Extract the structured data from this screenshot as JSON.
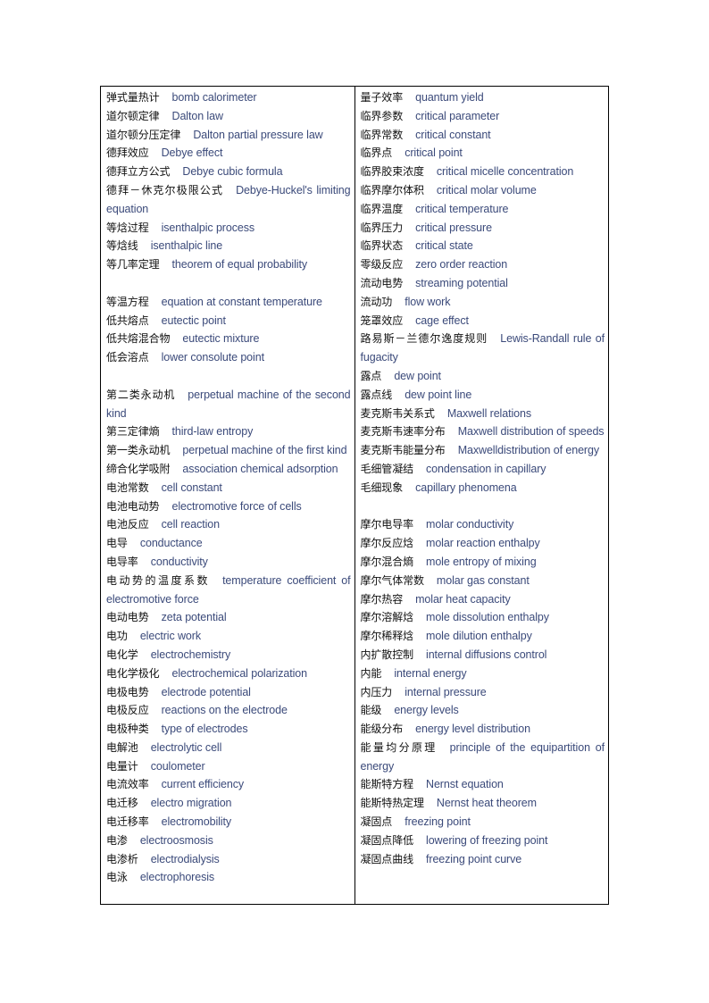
{
  "document": {
    "left_column": [
      {
        "zh": "弹式量热计",
        "en": "bomb calorimeter"
      },
      {
        "zh": "道尔顿定律",
        "en": "Dalton law"
      },
      {
        "zh": "道尔顿分压定律",
        "en": "Dalton partial pressure law"
      },
      {
        "zh": "德拜效应",
        "en": "Debye effect"
      },
      {
        "zh": "德拜立方公式",
        "en": "Debye cubic formula"
      },
      {
        "zh": "德拜－休克尔极限公式",
        "en": "Debye-Huckel's limiting equation"
      },
      {
        "zh": "等焓过程",
        "en": "isenthalpic process"
      },
      {
        "zh": "等焓线",
        "en": "isenthalpic line"
      },
      {
        "zh": "等几率定理",
        "en": "theorem of equal probability"
      },
      {
        "zh": "",
        "en": ""
      },
      {
        "zh": "等温方程",
        "en": "equation at constant temperature"
      },
      {
        "zh": "低共熔点",
        "en": "eutectic point"
      },
      {
        "zh": "低共熔混合物",
        "en": "eutectic mixture"
      },
      {
        "zh": "低会溶点",
        "en": "lower consolute point"
      },
      {
        "zh": "",
        "en": ""
      },
      {
        "zh": "第二类永动机",
        "en": "perpetual machine of the second kind"
      },
      {
        "zh": "第三定律熵",
        "en": "third-law entropy"
      },
      {
        "zh": "第一类永动机",
        "en": "perpetual machine of the first kind"
      },
      {
        "zh": "缔合化学吸附",
        "en": "association chemical adsorption"
      },
      {
        "zh": "电池常数",
        "en": "cell constant"
      },
      {
        "zh": "电池电动势",
        "en": "electromotive force of cells"
      },
      {
        "zh": "电池反应",
        "en": "cell reaction"
      },
      {
        "zh": "电导",
        "en": "conductance"
      },
      {
        "zh": "电导率",
        "en": "conductivity"
      },
      {
        "zh": "电动势的温度系数",
        "en": "temperature coefficient of electromotive force"
      },
      {
        "zh": "电动电势",
        "en": "zeta potential"
      },
      {
        "zh": "电功",
        "en": "electric work"
      },
      {
        "zh": "电化学",
        "en": "electrochemistry"
      },
      {
        "zh": "电化学极化",
        "en": "electrochemical polarization"
      },
      {
        "zh": "电极电势",
        "en": "electrode potential"
      },
      {
        "zh": "电极反应",
        "en": "reactions on the electrode"
      },
      {
        "zh": "电极种类",
        "en": "type of electrodes"
      },
      {
        "zh": "电解池",
        "en": "electrolytic cell"
      },
      {
        "zh": "电量计",
        "en": "coulometer"
      },
      {
        "zh": "电流效率",
        "en": "current efficiency"
      },
      {
        "zh": "电迁移",
        "en": "electro migration"
      },
      {
        "zh": "电迁移率",
        "en": "electromobility"
      },
      {
        "zh": "电渗",
        "en": "electroosmosis"
      },
      {
        "zh": "电渗析",
        "en": "electrodialysis"
      },
      {
        "zh": "电泳",
        "en": "electrophoresis"
      }
    ],
    "right_column": [
      {
        "zh": "量子效率",
        "en": "quantum yield"
      },
      {
        "zh": "临界参数",
        "en": "critical parameter"
      },
      {
        "zh": "临界常数",
        "en": "critical constant"
      },
      {
        "zh": "临界点",
        "en": "critical point"
      },
      {
        "zh": "临界胶束浓度",
        "en": "critical micelle concentration"
      },
      {
        "zh": "临界摩尔体积",
        "en": "critical molar volume"
      },
      {
        "zh": "临界温度",
        "en": "critical temperature"
      },
      {
        "zh": "临界压力",
        "en": "critical pressure"
      },
      {
        "zh": "临界状态",
        "en": "critical state"
      },
      {
        "zh": "零级反应",
        "en": "zero order reaction"
      },
      {
        "zh": "流动电势",
        "en": "streaming potential"
      },
      {
        "zh": "流动功",
        "en": "flow work"
      },
      {
        "zh": "笼罩效应",
        "en": "cage effect"
      },
      {
        "zh": "路易斯－兰德尔逸度规则",
        "en": "Lewis-Randall rule of fugacity"
      },
      {
        "zh": "露点",
        "en": "dew point"
      },
      {
        "zh": "露点线",
        "en": "dew point line"
      },
      {
        "zh": "麦克斯韦关系式",
        "en": "Maxwell relations"
      },
      {
        "zh": "麦克斯韦速率分布",
        "en": "Maxwell distribution of speeds"
      },
      {
        "zh": "麦克斯韦能量分布",
        "en": "Maxwelldistribution of energy"
      },
      {
        "zh": "毛细管凝结",
        "en": "condensation in capillary"
      },
      {
        "zh": "毛细现象",
        "en": "capillary    phenomena"
      },
      {
        "zh": "",
        "en": ""
      },
      {
        "zh": "摩尔电导率",
        "en": "molar conductivity"
      },
      {
        "zh": "摩尔反应焓",
        "en": "molar reaction enthalpy"
      },
      {
        "zh": "摩尔混合熵",
        "en": "mole entropy of mixing"
      },
      {
        "zh": "摩尔气体常数",
        "en": "molar gas constant"
      },
      {
        "zh": "摩尔热容",
        "en": "molar heat capacity"
      },
      {
        "zh": "摩尔溶解焓",
        "en": "mole dissolution enthalpy"
      },
      {
        "zh": "摩尔稀释焓",
        "en": "mole dilution enthalpy"
      },
      {
        "zh": "内扩散控制",
        "en": "internal diffusions control"
      },
      {
        "zh": "内能",
        "en": "internal energy"
      },
      {
        "zh": "内压力",
        "en": "internal pressure"
      },
      {
        "zh": "能级",
        "en": "energy levels"
      },
      {
        "zh": "能级分布",
        "en": "energy level distribution"
      },
      {
        "zh": "能量均分原理",
        "en": "principle of the equipartition of energy"
      },
      {
        "zh": "能斯特方程",
        "en": "Nernst equation"
      },
      {
        "zh": "能斯特热定理",
        "en": "Nernst heat theorem"
      },
      {
        "zh": "凝固点",
        "en": "freezing point"
      },
      {
        "zh": "凝固点降低",
        "en": "lowering of freezing point"
      },
      {
        "zh": "凝固点曲线",
        "en": "freezing point curve"
      }
    ]
  }
}
